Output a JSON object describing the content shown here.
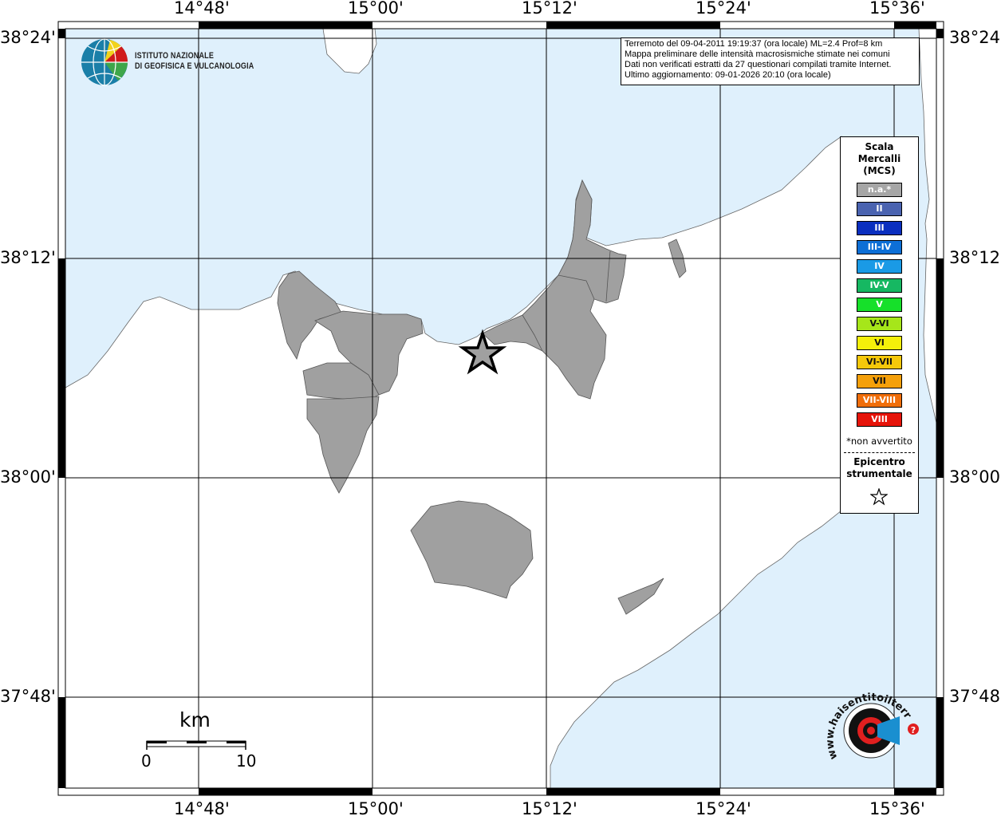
{
  "header": {
    "organization_line1": "ISTITUTO NAZIONALE",
    "organization_line2": "DI GEOFISICA E VULCANOLOGIA"
  },
  "info_box": {
    "line1": "Terremoto del 09-04-2011 19:19:37 (ora locale) ML=2.4 Prof=8 km",
    "line2": "Mappa preliminare delle intensità macrosismiche stimate nei comuni",
    "line3": "Dati non verificati estratti da 27 questionari compilati tramite Internet.",
    "line4": "Ultimo aggiornamento: 09-01-2026 20:10 (ora locale)"
  },
  "axes": {
    "longitude_labels": [
      "14°48'",
      "15°00'",
      "15°12'",
      "15°24'",
      "15°36'"
    ],
    "latitude_labels": [
      "38°24'",
      "38°12'",
      "38°00'",
      "37°48'"
    ]
  },
  "legend": {
    "title_line1": "Scala",
    "title_line2": "Mercalli",
    "title_line3": "(MCS)",
    "items": [
      {
        "label": "n.a.*",
        "color": "#a6a6a6"
      },
      {
        "label": "II",
        "color": "#4a63b0"
      },
      {
        "label": "III",
        "color": "#0a2fbf"
      },
      {
        "label": "III-IV",
        "color": "#0d6fd6"
      },
      {
        "label": "IV",
        "color": "#1a9ae6"
      },
      {
        "label": "IV-V",
        "color": "#16b862"
      },
      {
        "label": "V",
        "color": "#16e02a"
      },
      {
        "label": "V-VI",
        "color": "#a6e61a"
      },
      {
        "label": "VI",
        "color": "#f5f00a"
      },
      {
        "label": "VI-VII",
        "color": "#f5c80a"
      },
      {
        "label": "VII",
        "color": "#f5a00a"
      },
      {
        "label": "VII-VIII",
        "color": "#f06e0a"
      },
      {
        "label": "VIII",
        "color": "#e6140a"
      }
    ],
    "note": "*non avvertito",
    "epicenter_line1": "Epicentro",
    "epicenter_line2": "strumentale"
  },
  "scale_bar": {
    "unit": "km",
    "start": "0",
    "end": "10"
  },
  "footer_logo": {
    "text": "www.haisentitoilterremoto.it"
  },
  "colors": {
    "sea": "#dff0fc",
    "land": "#ffffff",
    "municipality": "#a0a0a0",
    "grid": "#000000"
  }
}
